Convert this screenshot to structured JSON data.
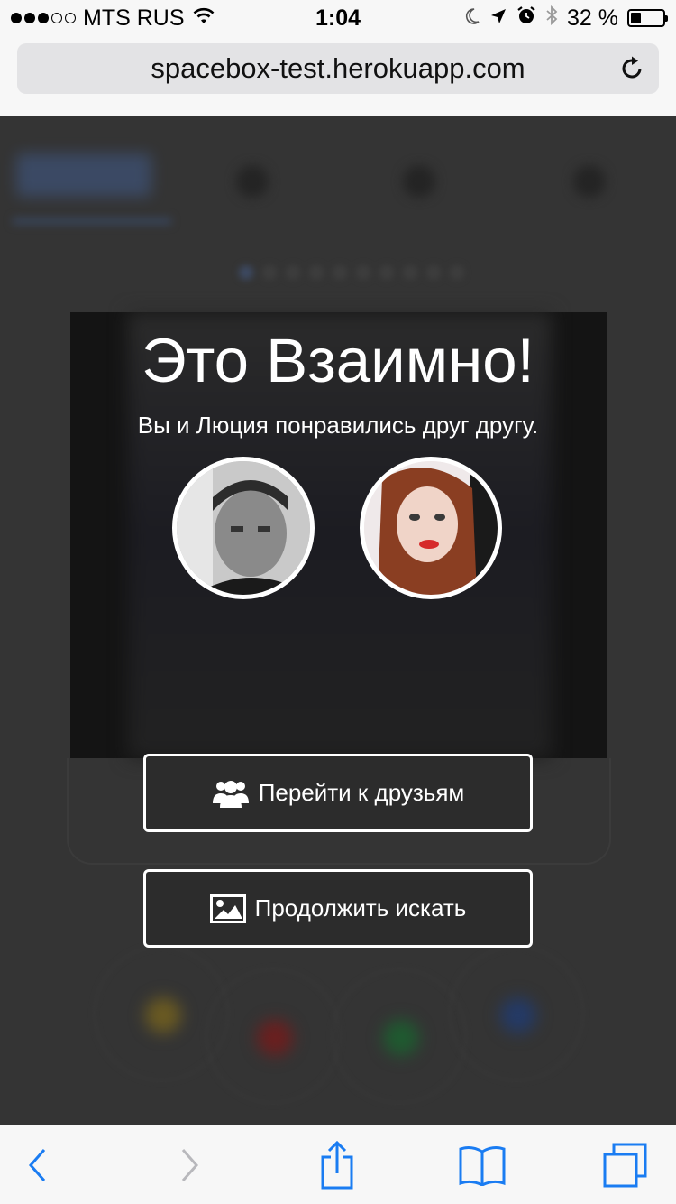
{
  "status_bar": {
    "carrier": "MTS RUS",
    "time": "1:04",
    "battery_percent": "32 %",
    "battery_level": 0.32,
    "signal_strength": 3,
    "signal_max": 5
  },
  "browser": {
    "url": "spacebox-test.herokuapp.com"
  },
  "match": {
    "title": "Это Взаимно!",
    "subtitle": "Вы и Люция понравились друг другу."
  },
  "actions": {
    "friends_label": "Перейти к друзьям",
    "continue_label": "Продолжить искать"
  },
  "icons": {
    "signal": "cellular-signal-icon",
    "wifi": "wifi-icon",
    "moon": "do-not-disturb-moon-icon",
    "location": "location-arrow-icon",
    "alarm": "alarm-clock-icon",
    "bluetooth": "bluetooth-icon",
    "battery": "battery-icon",
    "reload": "reload-icon",
    "friends": "users-group-icon",
    "continue": "image-icon",
    "back": "chevron-left-icon",
    "forward": "chevron-right-icon",
    "share": "share-icon",
    "bookmarks": "book-icon",
    "tabs": "tabs-icon"
  },
  "colors": {
    "accent": "#1a7cf2",
    "overlay_bg": "#2f2f2f",
    "text_on_overlay": "#ffffff",
    "disabled": "#b8b8bc"
  }
}
